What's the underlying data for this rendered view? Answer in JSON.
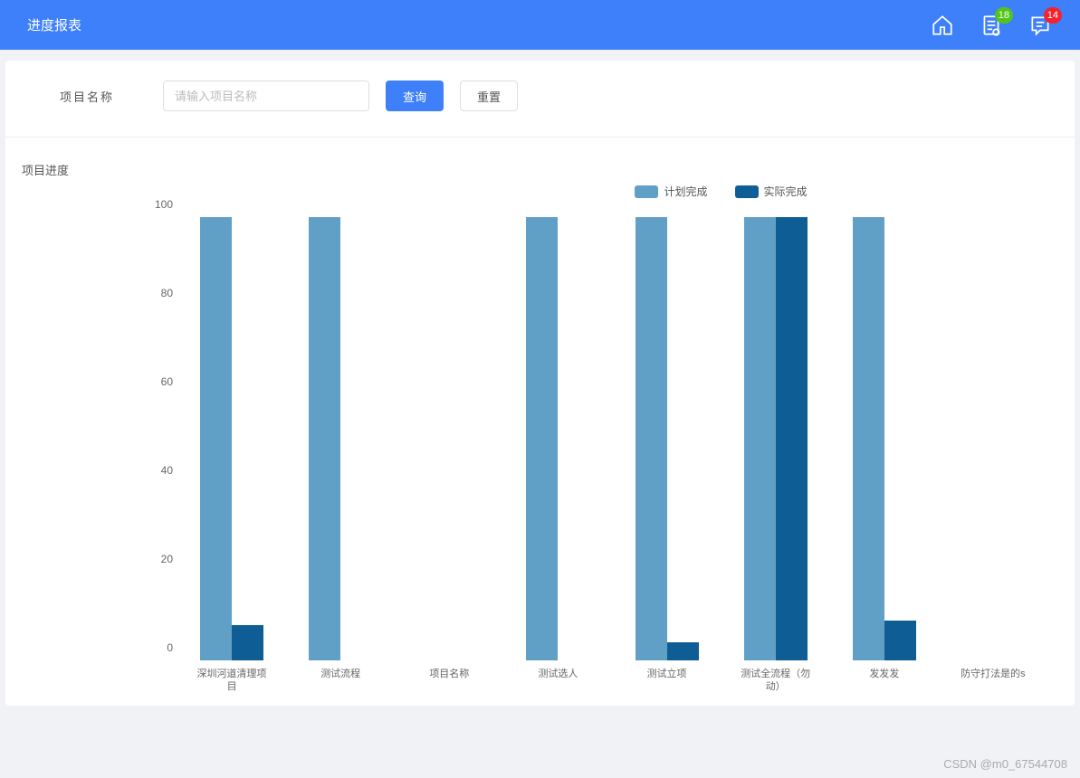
{
  "header": {
    "title": "进度报表",
    "badge_docs": "18",
    "badge_chat": "14"
  },
  "filter": {
    "label": "项目名称",
    "placeholder": "请输入项目名称",
    "search_btn": "查询",
    "reset_btn": "重置"
  },
  "section_title": "项目进度",
  "legend": {
    "plan": "计划完成",
    "actual": "实际完成"
  },
  "watermark": "CSDN @m0_67544708",
  "chart_data": {
    "type": "bar",
    "ylim": [
      0,
      100
    ],
    "yticks": [
      0,
      20,
      40,
      60,
      80,
      100
    ],
    "categories": [
      "深圳河道清理项目",
      "测试流程",
      "项目名称",
      "测试选人",
      "测试立项",
      "测试全流程（勿动）",
      "发发发",
      "防守打法是的s"
    ],
    "series": [
      {
        "name": "计划完成",
        "values": [
          100,
          100,
          0,
          100,
          100,
          100,
          100,
          0
        ]
      },
      {
        "name": "实际完成",
        "values": [
          8,
          0,
          0,
          0,
          4,
          100,
          9,
          0
        ]
      }
    ]
  }
}
